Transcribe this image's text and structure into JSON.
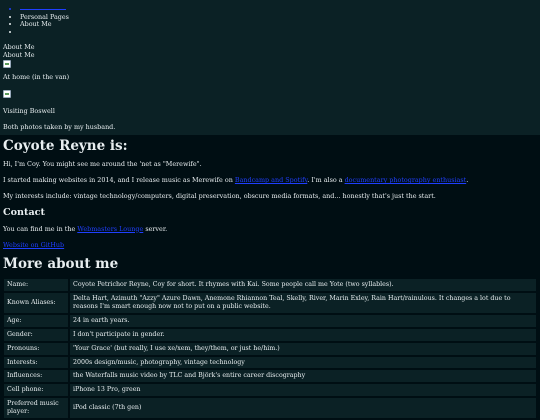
{
  "nav": {
    "items": [
      "",
      "Personal Pages",
      "About Me",
      ""
    ]
  },
  "about": {
    "label1": "About Me",
    "label2": "About Me",
    "caption_home": "At home (in the van)",
    "caption_boswell": "Visiting Boswell",
    "caption_credit": "Both photos taken by my husband."
  },
  "intro": {
    "heading": "Coyote Reyne is:",
    "p1": "Hi, I'm Coy. You might see me around the 'net as \"Merewife\".",
    "p2_pre": "I started making websites in 2014, and I release music as Merewife on",
    "p2_link1": "Bandcamp and Spotify",
    "p2_mid": ". I'm also a",
    "p2_link2": "documentary photography enthusiast",
    "p2_post": ".",
    "p3": "My interests include: vintage technology/computers, digital preservation, obscure media formats, and... honestly that's just the start."
  },
  "contact": {
    "heading": "Contact",
    "text_pre": "You can find me in the",
    "link": "Webmasters Lounge",
    "text_post": "server.",
    "extra_link": "Website on GitHub"
  },
  "more": {
    "heading": "More about me",
    "rows": [
      {
        "k": "Name:",
        "v": "Coyote Petrichor Reyne, Coy for short. It rhymes with Kai. Some people call me Yote (two syllables)."
      },
      {
        "k": "Known Aliases:",
        "v": "Delta Hart, Azimuth \"Azzy\" Azure Dawn, Anemone Rhiannon Teal, Skelly, River, Marin Exley, Rain Hart/rainulous. It changes a lot due to reasons I'm smart enough now not to put on a public website."
      },
      {
        "k": "Age:",
        "v": "24 in earth years."
      },
      {
        "k": "Gender:",
        "v": "I don't participate in gender."
      },
      {
        "k": "Pronouns:",
        "v": "'Your Grace' (but really, I use xe/xem, they/them, or just he/him.)"
      },
      {
        "k": "Interests:",
        "v": "2000s design/music, photography, vintage technology"
      },
      {
        "k": "Influences:",
        "v": "the Waterfalls music video by TLC and Björk's entire career discography"
      },
      {
        "k": "Cell phone:",
        "v": "iPhone 13 Pro, green"
      },
      {
        "k": "Preferred music player:",
        "v": "iPod classic (7th gen)"
      }
    ]
  }
}
